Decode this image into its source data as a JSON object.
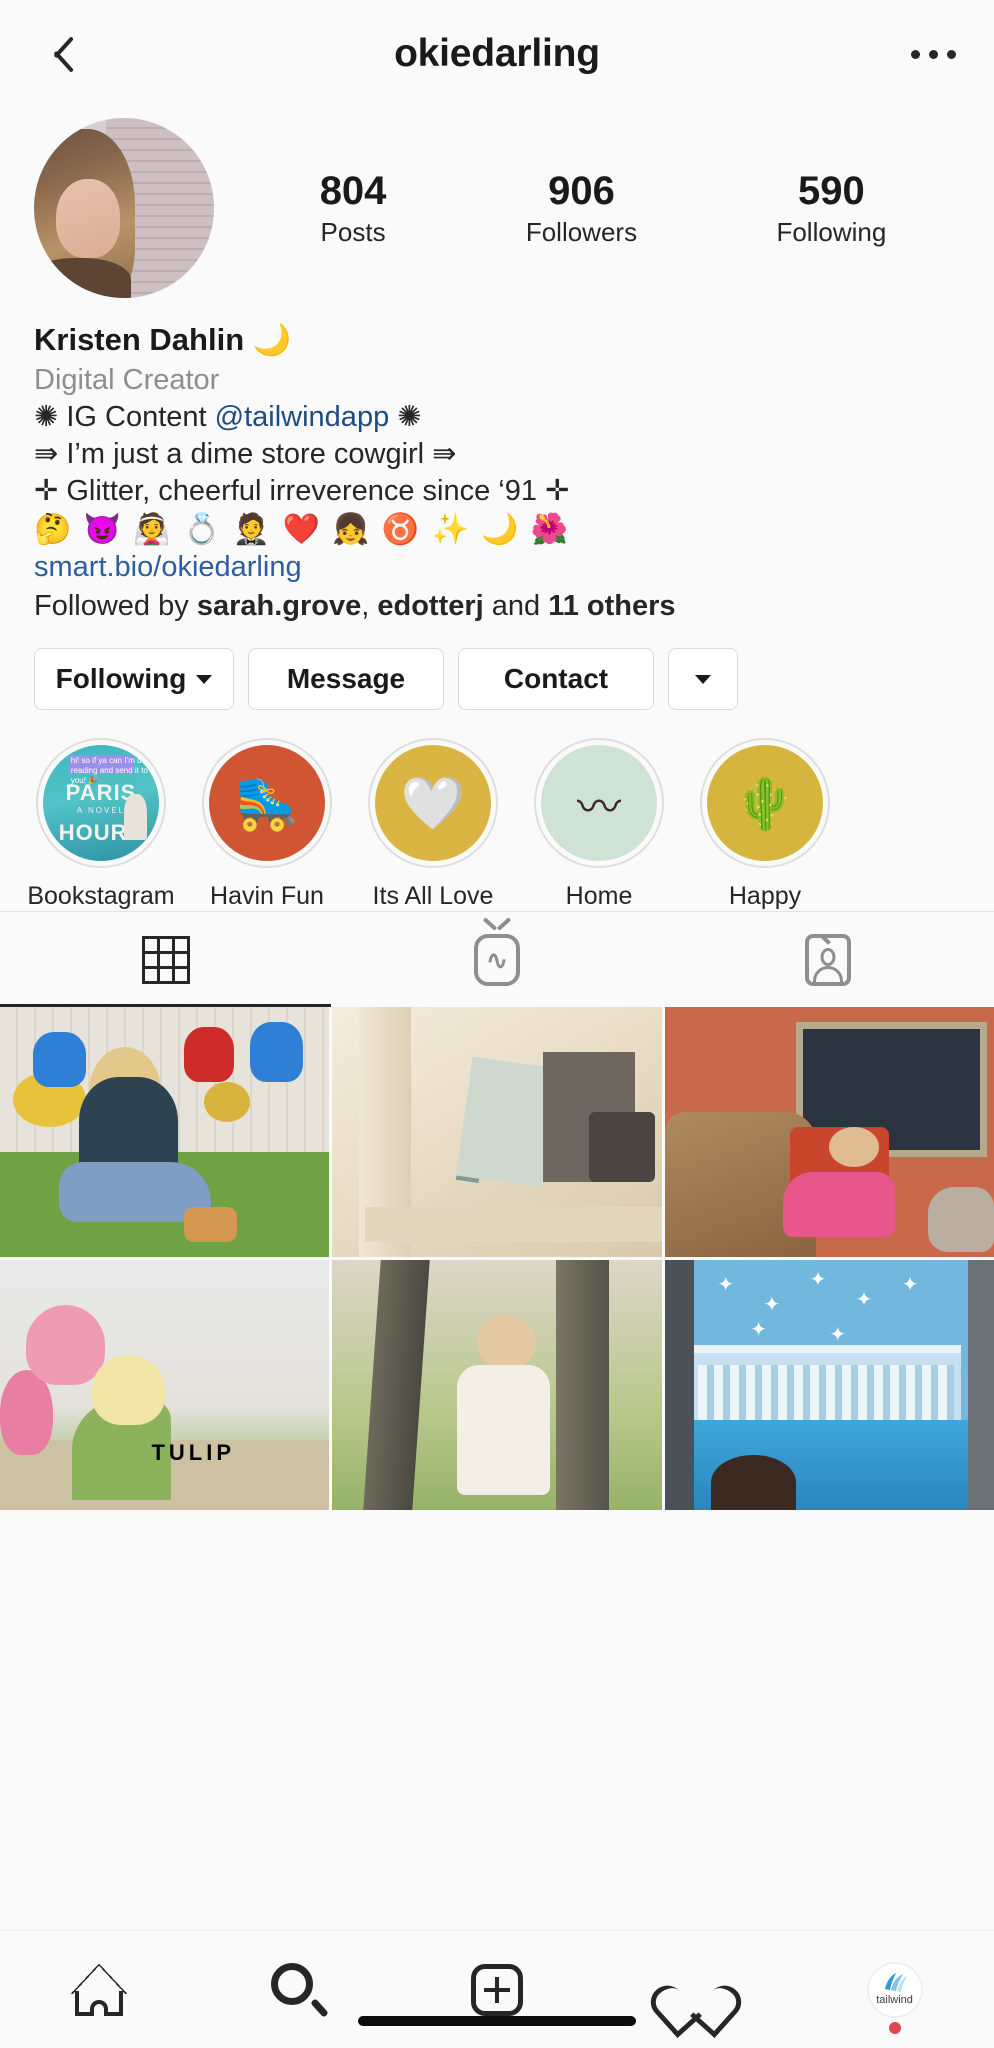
{
  "topbar": {
    "back_icon": "back-chevron-icon",
    "username": "okiedarling",
    "more_icon": "more-options-icon"
  },
  "profile": {
    "avatar_alt": "profile-picture",
    "stats": [
      {
        "num": "804",
        "label": "Posts"
      },
      {
        "num": "906",
        "label": "Followers"
      },
      {
        "num": "590",
        "label": "Following"
      }
    ]
  },
  "bio": {
    "name": "Kristen Dahlin 🌙",
    "category": "Digital Creator",
    "line1_prefix": "✺ IG Content ",
    "line1_mention": "@tailwindapp",
    "line1_suffix": " ✺",
    "line2": "⇛ I’m just a dime store cowgirl ⇛",
    "line3": "✛ Glitter, cheerful irreverence since ‘91 ✛",
    "emoji_line": "🤔 😈 👰 💍 🤵 ❤️ 👧 ♉ ✨ 🌙 🌺",
    "link": "smart.bio/okiedarling",
    "followed_by_prefix": "Followed by ",
    "followed_by_user1": "sarah.grove",
    "followed_by_sep": ", ",
    "followed_by_user2": "edotterj",
    "followed_by_mid": " and ",
    "followed_by_others": "11 others"
  },
  "actions": {
    "following_label": "Following",
    "following_caret_icon": "chevron-down-icon",
    "message_label": "Message",
    "contact_label": "Contact",
    "expand_caret_icon": "chevron-down-icon"
  },
  "highlights": [
    {
      "label": "Bookstagram",
      "cover": "paris-hours-book",
      "glyph": ""
    },
    {
      "label": "Havin Fun",
      "cover": "roller-skate",
      "glyph": ""
    },
    {
      "label": "Its All Love",
      "cover": "heart-doodle",
      "glyph": ""
    },
    {
      "label": "Home",
      "cover": "mustache",
      "glyph": ""
    },
    {
      "label": "Happy",
      "cover": "cactus",
      "glyph": ""
    }
  ],
  "highlight_art": {
    "book_badge_text": "hi! so if ya can\nI’m done reading and\nsend it to you! 🎉",
    "book_title_top": "PARIS",
    "book_subtitle": "A NOVEL",
    "book_title_bottom": "HOURS"
  },
  "tabs": [
    {
      "icon": "grid-icon",
      "name": "posts-tab",
      "active": true
    },
    {
      "icon": "igtv-icon",
      "name": "igtv-tab",
      "active": false
    },
    {
      "icon": "tagged-icon",
      "name": "tagged-tab",
      "active": false
    }
  ],
  "photo_grid": [
    {
      "alt": "woman-sitting-by-floral-mural"
    },
    {
      "alt": "coffee-bag-book-and-mug"
    },
    {
      "alt": "toddler-on-leather-couch"
    },
    {
      "alt": "pink-and-yellow-tulips"
    },
    {
      "alt": "toddler-between-trees"
    },
    {
      "alt": "poolside-colonnade-with-stars"
    }
  ],
  "photo_grid_text": {
    "tulip_letters": "TULIP"
  },
  "bottom_nav": [
    {
      "icon": "home-icon",
      "name": "nav-home"
    },
    {
      "icon": "search-icon",
      "name": "nav-search"
    },
    {
      "icon": "plus-square-icon",
      "name": "nav-create"
    },
    {
      "icon": "heart-icon",
      "name": "nav-activity"
    },
    {
      "icon": "profile-avatar",
      "name": "nav-profile",
      "label": "tailwind"
    }
  ],
  "colors": {
    "background": "#fafafa",
    "text_primary": "#262626",
    "text_secondary": "#8e8e8e",
    "link": "#2e5e9e",
    "border": "#dbdbdb",
    "badge_red": "#e0454f"
  }
}
